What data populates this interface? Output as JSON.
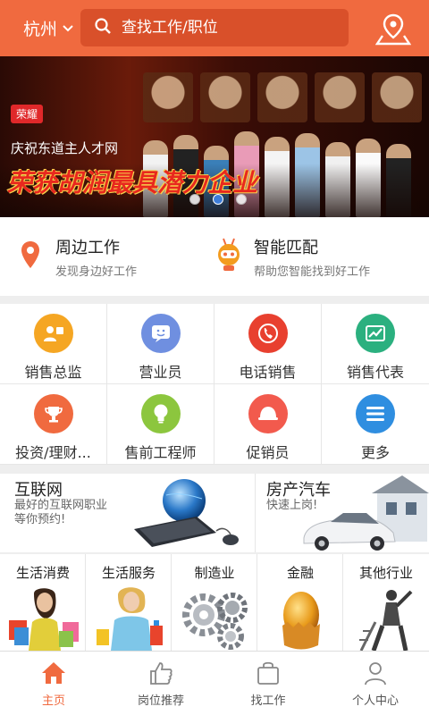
{
  "header": {
    "city": "杭州",
    "search_placeholder": "查找工作/职位"
  },
  "banner": {
    "badge": "荣耀",
    "subtitle": "庆祝东道主人才网",
    "title": "荣获胡润最具潜力企业",
    "slide_count": 3,
    "active_slide": 2
  },
  "features": [
    {
      "title": "周边工作",
      "desc": "发现身边好工作",
      "icon": "map-pin-icon"
    },
    {
      "title": "智能匹配",
      "desc": "帮助您智能找到好工作",
      "icon": "robot-icon"
    }
  ],
  "categories": [
    {
      "label": "销售总监",
      "icon": "director-icon",
      "color": "#f5a623"
    },
    {
      "label": "营业员",
      "icon": "chat-face-icon",
      "color": "#6f8fe0"
    },
    {
      "label": "电话销售",
      "icon": "phone-icon",
      "color": "#e8402f"
    },
    {
      "label": "销售代表",
      "icon": "trend-chart-icon",
      "color": "#2bb07f"
    },
    {
      "label": "投资/理财...",
      "icon": "trophy-icon",
      "color": "#f06a3f"
    },
    {
      "label": "售前工程师",
      "icon": "bulb-icon",
      "color": "#8cc63e"
    },
    {
      "label": "促销员",
      "icon": "cap-icon",
      "color": "#f25a4d"
    },
    {
      "label": "更多",
      "icon": "menu-icon",
      "color": "#2f8ee0"
    }
  ],
  "industries_top": [
    {
      "title": "互联网",
      "desc_line1": "最好的互联网职业",
      "desc_line2": "等你预约!",
      "icon": "globe-keyboard-icon"
    },
    {
      "title": "房产汽车",
      "desc_line1": "快速上岗!",
      "desc_line2": "",
      "icon": "house-car-icon"
    }
  ],
  "industries_bottom": [
    {
      "label": "生活消费",
      "icon": "shopping-woman-icon"
    },
    {
      "label": "生活服务",
      "icon": "cleaning-woman-icon"
    },
    {
      "label": "制造业",
      "icon": "gears-icon"
    },
    {
      "label": "金融",
      "icon": "golden-egg-icon"
    },
    {
      "label": "其他行业",
      "icon": "statue-icon"
    }
  ],
  "tabs": [
    {
      "label": "主页",
      "icon": "home-icon",
      "active": true
    },
    {
      "label": "岗位推荐",
      "icon": "thumbs-up-icon",
      "active": false
    },
    {
      "label": "找工作",
      "icon": "bag-icon",
      "active": false
    },
    {
      "label": "个人中心",
      "icon": "person-icon",
      "active": false
    }
  ],
  "colors": {
    "brand": "#f06a3f",
    "search_bg": "#d9502a",
    "dot_active": "#3d7dd8"
  }
}
